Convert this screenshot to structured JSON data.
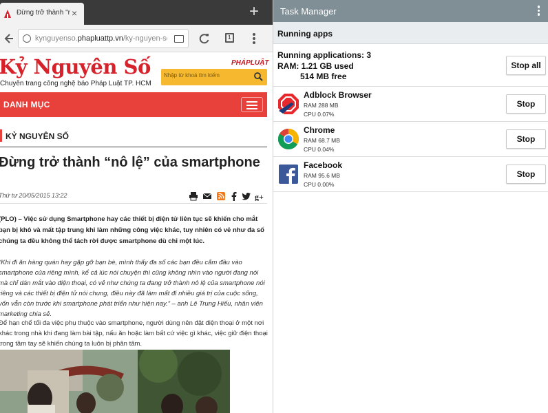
{
  "browser": {
    "tab": {
      "title": "Đừng trở thành \"n",
      "close": "×"
    },
    "new_tab": "+",
    "address": {
      "prefix": "kynguyenso.",
      "host": "phapluattp.vn",
      "path": "/ky-nguyen-so"
    }
  },
  "site": {
    "logo": "Kỷ Nguyên Số",
    "tagline": "Chuyên trang công nghệ báo Pháp Luật TP. HCM",
    "badge": "PHÁPLUẬT",
    "search_placeholder": "Nhập từ khoá tìm kiếm",
    "category_label": "DANH MỤC"
  },
  "article": {
    "section": "KỶ NGUYÊN SỐ",
    "headline": "Đừng trở thành “nô lệ” của smartphone",
    "date": "Thứ tư 20/05/2015 13:22",
    "lede": "(PLO) – Việc sử dụng Smartphone hay các thiết bị điện tử liên tục sẽ khiến cho mắt bạn bị khô và mất tập trung khi làm những công việc khác, tuy nhiên có vẻ như đa số chúng ta đều không thể tách rời được smartphone dù chỉ một lúc.",
    "quote": "“Khi đi ăn hàng quán hay gặp gỡ bạn bè, mình thấy đa số các bạn đều cắm đầu vào smartphone của riêng mình, kể cả lúc nói chuyện thì cũng không nhìn vào người đang nói mà chỉ dán mắt vào điện thoại, có vẻ như chúng ta đang trở thành nô lệ của smartphone nói riêng và các thiết bị điện tử nói chung, điều này đã làm mất đi nhiều giá trị của cuộc sống, vốn vẫn còn trước khi smartphone phát triển như hiện nay.” – anh Lê Trung Hiếu, nhân viên marketing chia sẻ.",
    "body": "Để hạn chế tối đa việc phụ thuộc vào smartphone, người dùng nên đặt điện thoại ở một nơi khác trong nhà khi đang làm bài tập, nấu ăn hoặc làm bất cứ việc gì khác, việc giữ điện thoại trong tầm tay sẽ khiến chúng ta luôn bị phân tâm."
  },
  "task_manager": {
    "title": "Task Manager",
    "subtitle": "Running apps",
    "running_label": "Running applications: 3",
    "ram_used": "RAM: 1.21 GB used",
    "ram_free": "514 MB free",
    "stop_all": "Stop all",
    "apps": [
      {
        "name": "Adblock Browser",
        "ram": "RAM 288 MB",
        "cpu": "CPU 0.07%",
        "stop": "Stop",
        "icon": "adblock-icon"
      },
      {
        "name": "Chrome",
        "ram": "RAM 68.7 MB",
        "cpu": "CPU 0.04%",
        "stop": "Stop",
        "icon": "chrome-icon"
      },
      {
        "name": "Facebook",
        "ram": "RAM 95.6 MB",
        "cpu": "CPU 0.00%",
        "stop": "Stop",
        "icon": "facebook-icon"
      }
    ]
  },
  "colors": {
    "site_red": "#d6222a",
    "category_bar": "#e8413b",
    "search_orange": "#f5b82e",
    "tm_header": "#7f8f95",
    "tm_subheader": "#e9edef"
  }
}
